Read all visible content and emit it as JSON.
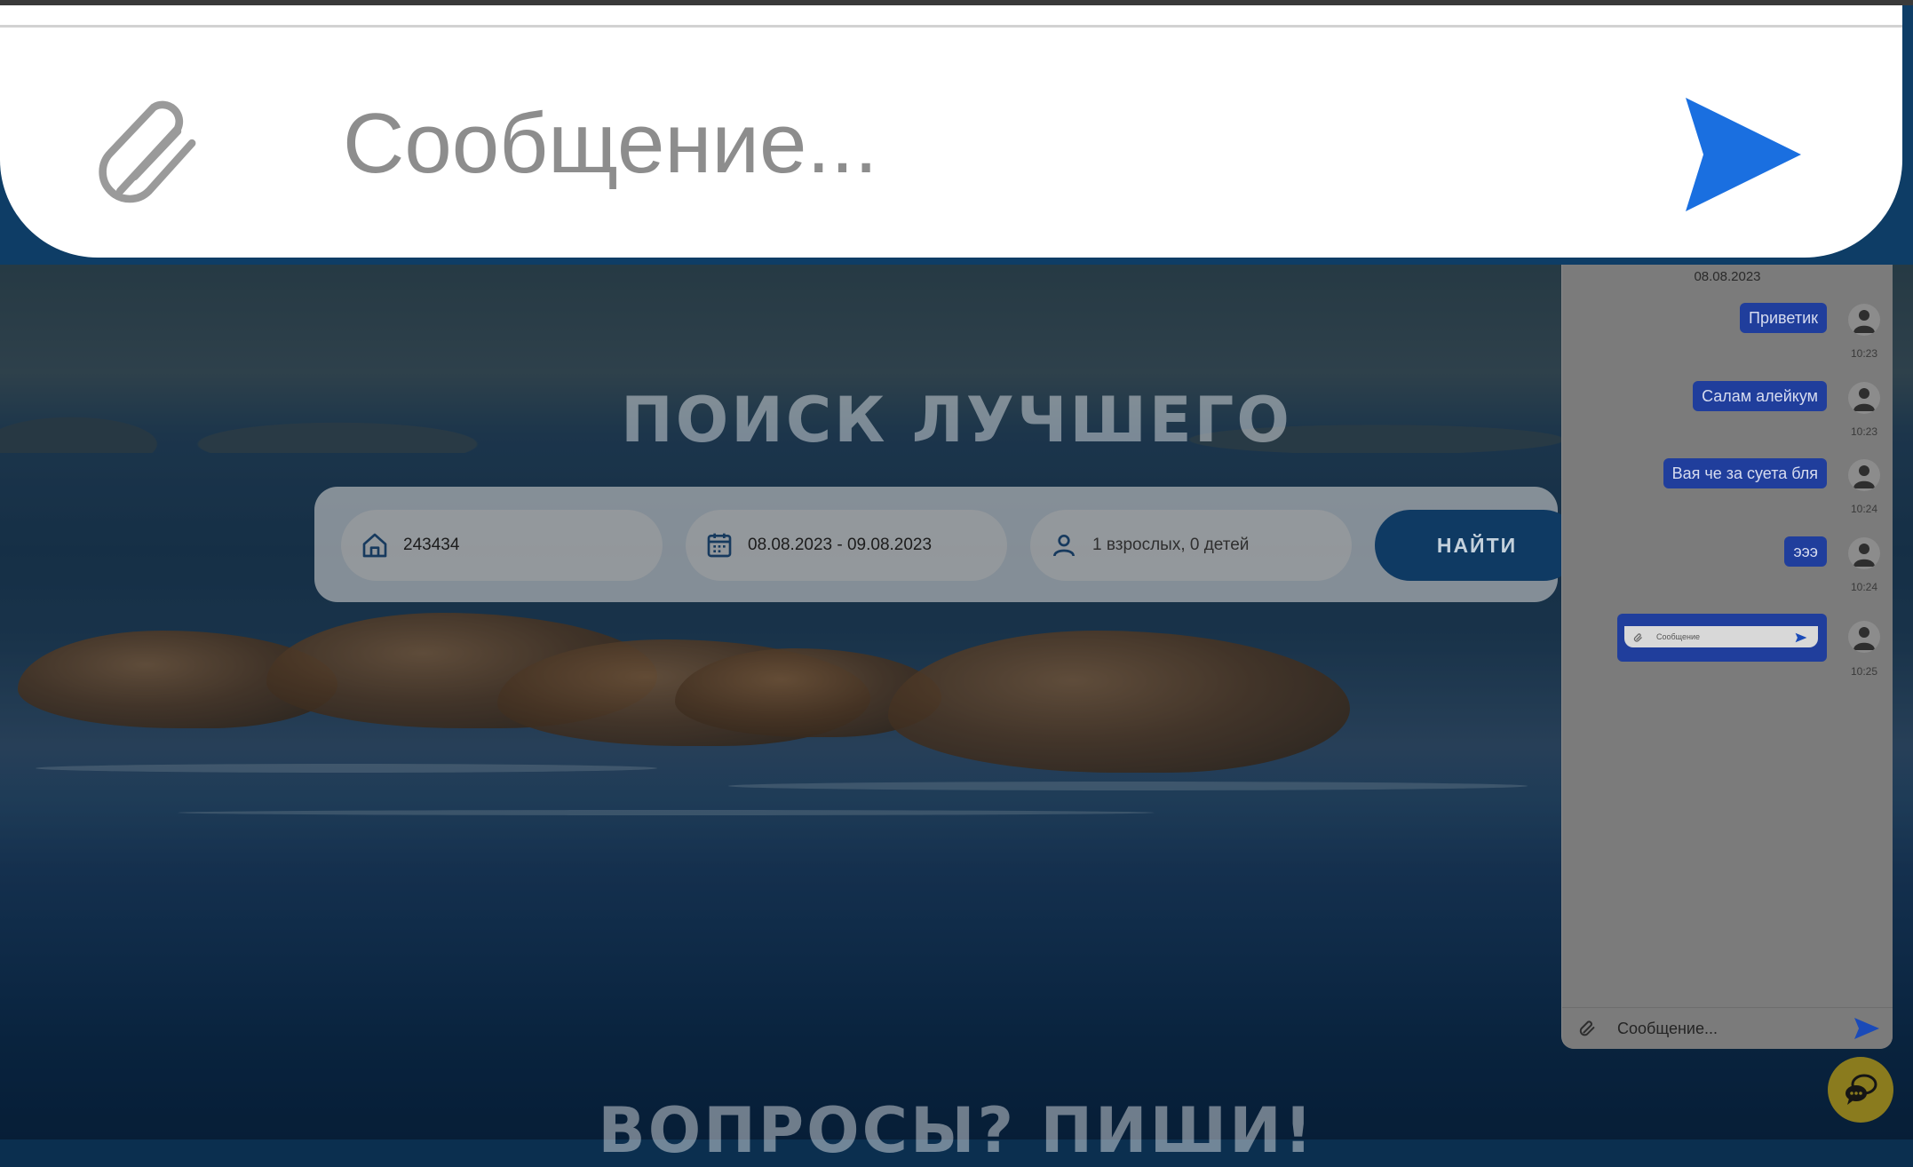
{
  "composer_zoom": {
    "placeholder": "Сообщение...",
    "attach_icon": "paperclip-icon",
    "send_icon": "send-arrow-icon",
    "accent_color": "#1a6fe0"
  },
  "hero": {
    "title": "ПОИСК ЛУЧШЕГО",
    "footer_title": "ВОПРОСЫ? ПИШИ!"
  },
  "search": {
    "location_value": "243434",
    "dates_value": "08.08.2023 - 09.08.2023",
    "guests_value": "1 взрослых, 0 детей",
    "find_label": "НАЙТИ",
    "location_icon": "home-icon",
    "dates_icon": "calendar-icon",
    "guests_icon": "person-icon"
  },
  "chat": {
    "date": "08.08.2023",
    "messages": [
      {
        "text": "Приветик",
        "time": "10:23"
      },
      {
        "text": "Салам алейкум",
        "time": "10:23"
      },
      {
        "text": "Вая че за суета бля",
        "time": "10:24"
      },
      {
        "text": "эээ",
        "time": "10:24"
      },
      {
        "text": "",
        "time": "10:25",
        "image_text": "Сообщение"
      }
    ],
    "input_placeholder": "Сообщение...",
    "bubble_color": "#203e9c"
  },
  "fab": {
    "icon": "chat-bubbles-icon",
    "color": "#8a7b1e"
  }
}
